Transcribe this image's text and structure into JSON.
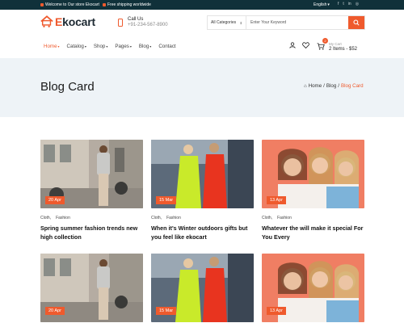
{
  "topbar": {
    "welcome": "Welcome to Our store Ekocart",
    "shipping": "Free shipping worldwide",
    "language": "English",
    "social_icons": [
      "facebook-icon",
      "twitter-icon",
      "linkedin-icon",
      "instagram-icon"
    ]
  },
  "header": {
    "logo_prefix": "E",
    "logo_rest": "kocart",
    "call_label": "Call Us",
    "phone": "+91-234-567-8900",
    "search": {
      "category": "All Categories",
      "placeholder": "Enter Your Keyword"
    },
    "nav": [
      {
        "label": "Home",
        "active": true
      },
      {
        "label": "Catalog"
      },
      {
        "label": "Shop"
      },
      {
        "label": "Pages"
      },
      {
        "label": "Blog"
      },
      {
        "label": "Contact"
      }
    ],
    "cart": {
      "badge": "2",
      "label": "My Cart",
      "summary": "2 Items - $52"
    }
  },
  "banner": {
    "title": "Blog Card",
    "breadcrumb": {
      "home": "Home",
      "sep1": "/",
      "blog": "Blog",
      "sep2": "/",
      "current": "Blog Card"
    }
  },
  "cards": [
    {
      "date": "20 Apr",
      "tag1": "Cloth,",
      "tag2": "Fashion",
      "title": "Spring summer fashion trends new high collection"
    },
    {
      "date": "15 Mar",
      "tag1": "Cloth,",
      "tag2": "Fashion",
      "title": "When it's Winter outdoors gifts but you feel like ekocart"
    },
    {
      "date": "13 Apr",
      "tag1": "Cloth,",
      "tag2": "Fashion",
      "title": "Whatever the will make it special For You Every"
    },
    {
      "date": "20 Apr"
    },
    {
      "date": "15 Mar"
    },
    {
      "date": "13 Apr"
    }
  ],
  "colors": {
    "accent": "#ef5a2d",
    "dark": "#10313a",
    "banner_bg": "#eef3f7"
  }
}
